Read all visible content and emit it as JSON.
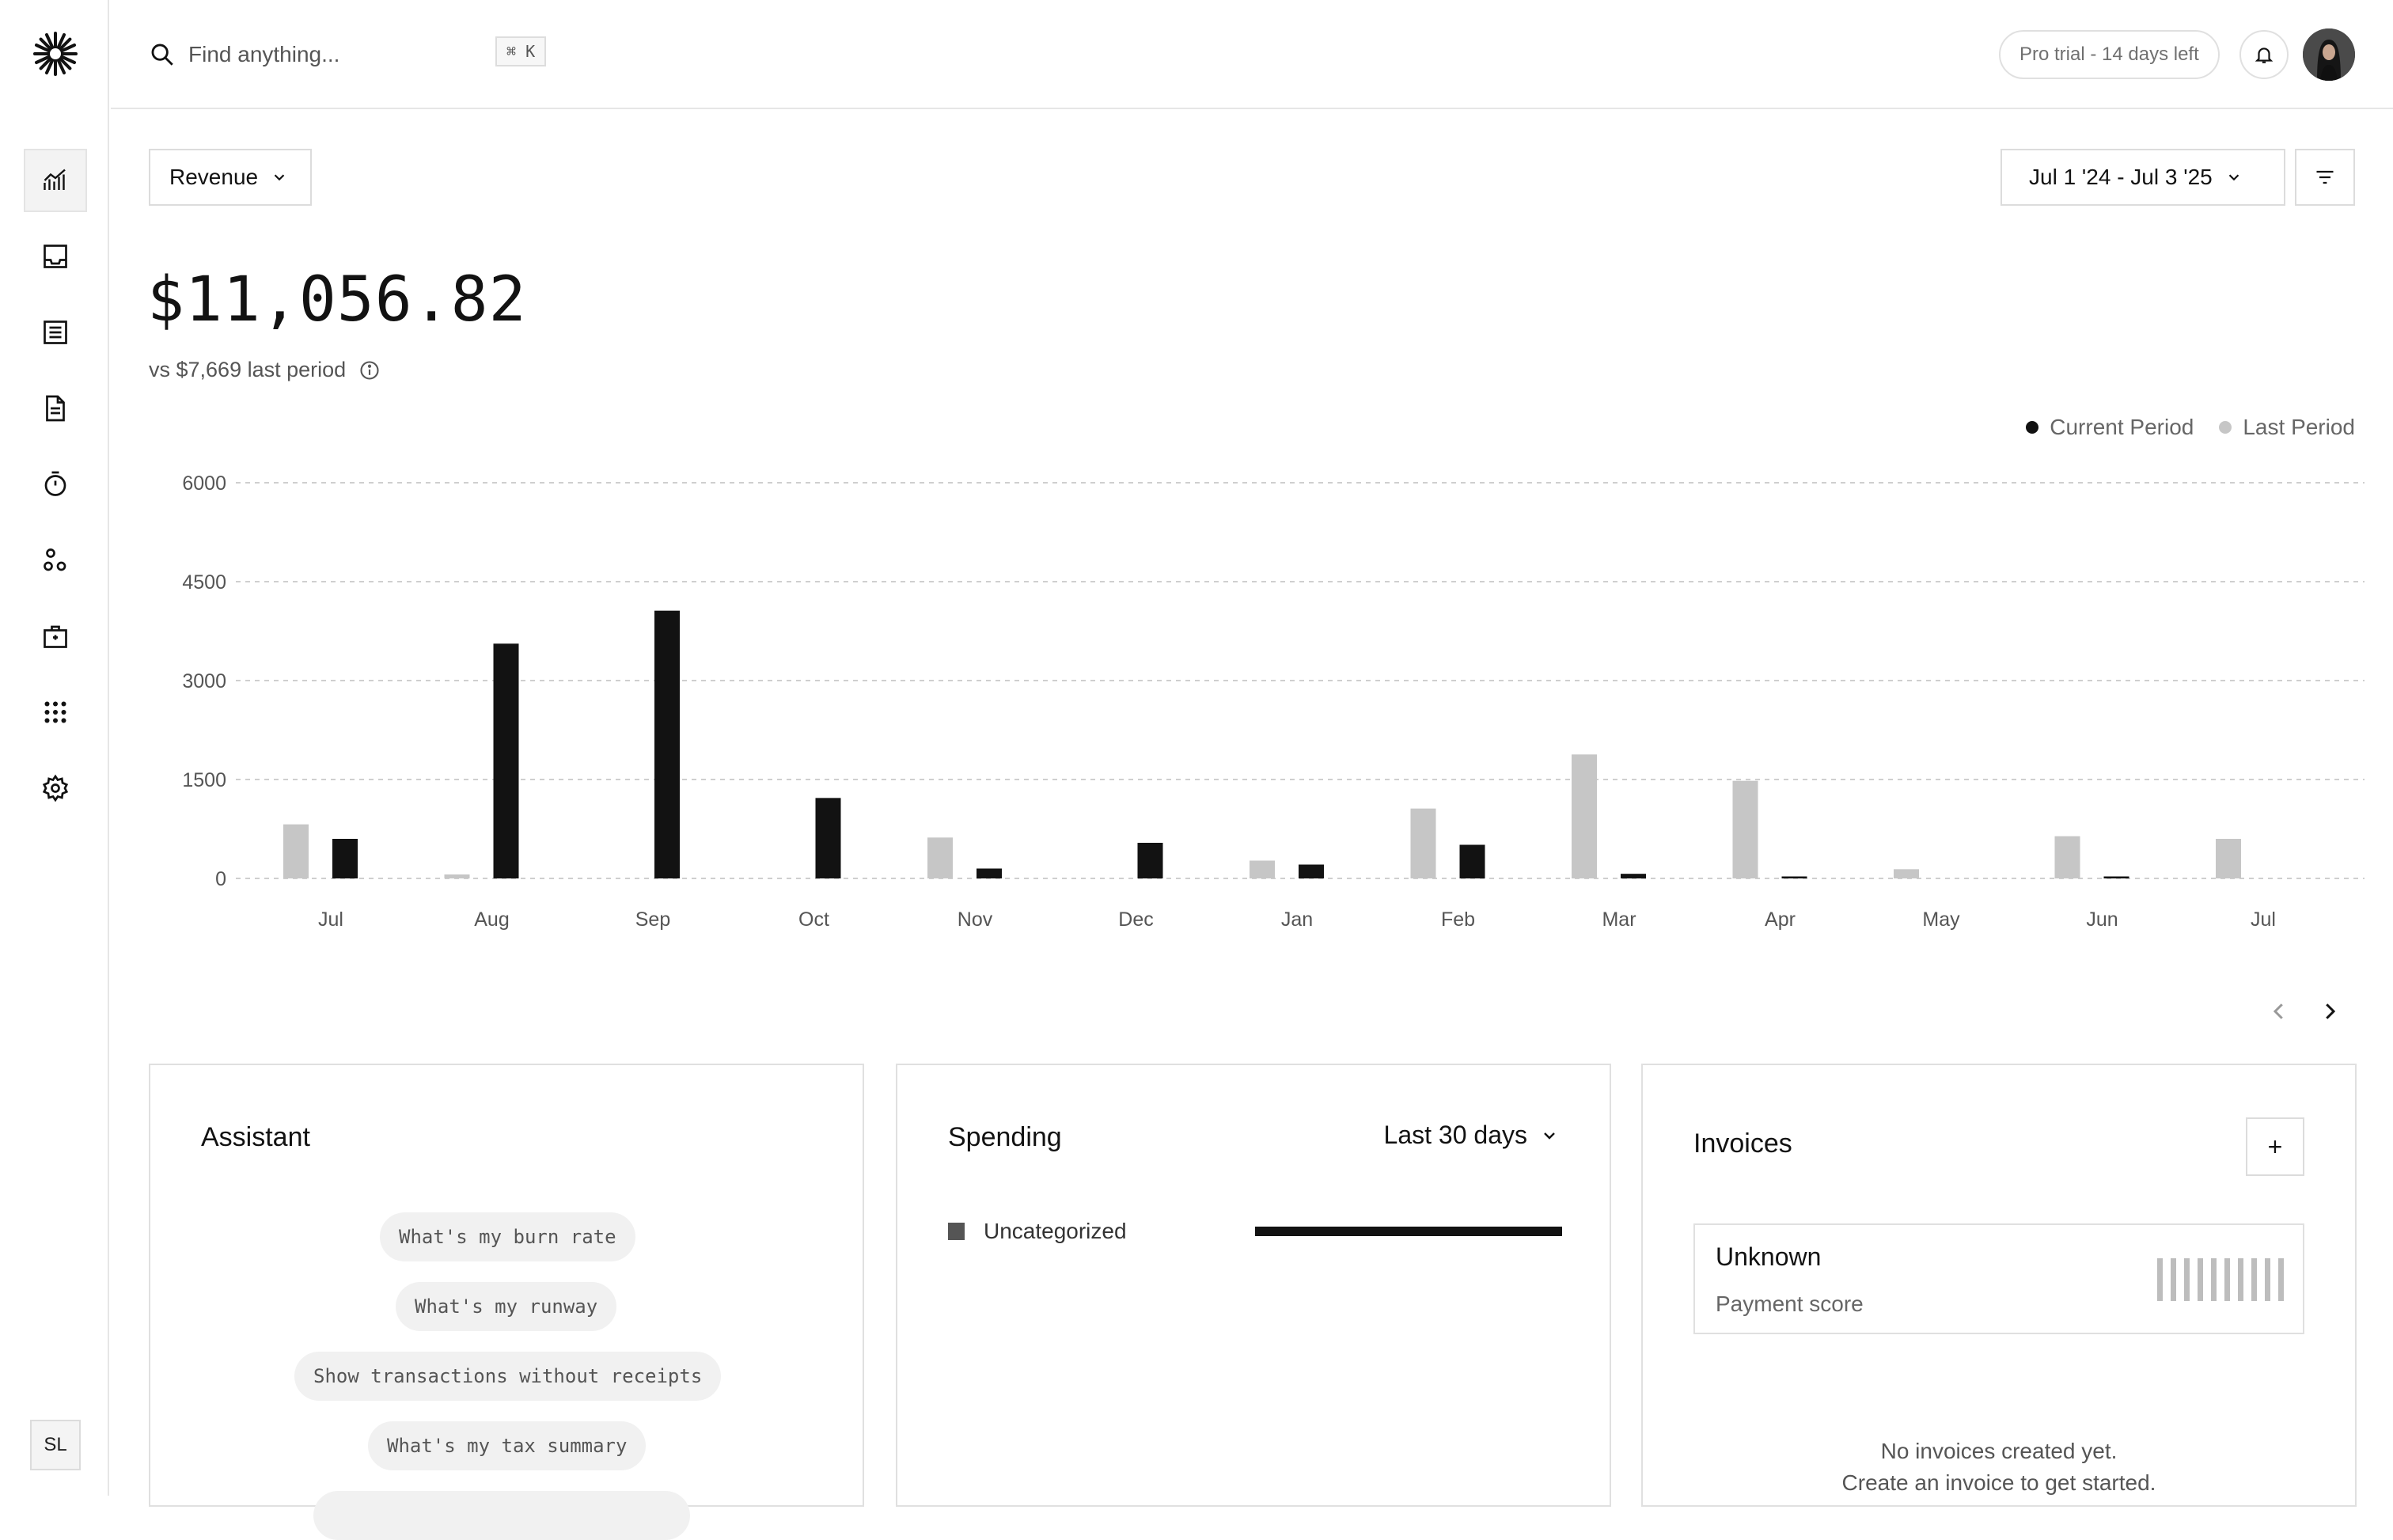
{
  "search": {
    "placeholder": "Find anything...",
    "shortcut": "⌘ K"
  },
  "header": {
    "trial_badge": "Pro trial - 14 days left"
  },
  "sidebar": {
    "items": [
      {
        "name": "overview",
        "icon": "chart-icon",
        "active": true
      },
      {
        "name": "inbox",
        "icon": "inbox-icon"
      },
      {
        "name": "transactions",
        "icon": "list-icon"
      },
      {
        "name": "invoices",
        "icon": "document-icon"
      },
      {
        "name": "tracker",
        "icon": "timer-icon"
      },
      {
        "name": "customers",
        "icon": "people-icon"
      },
      {
        "name": "vault",
        "icon": "briefcase-icon"
      },
      {
        "name": "apps",
        "icon": "grid-icon"
      },
      {
        "name": "settings",
        "icon": "gear-icon"
      }
    ],
    "user_initials": "SL"
  },
  "toolbar": {
    "metric_label": "Revenue",
    "date_range": "Jul 1 '24 - Jul 3 '25"
  },
  "summary": {
    "amount": "$11,056.82",
    "comparison": "vs $7,669 last period"
  },
  "legend": {
    "current": "Current Period",
    "last": "Last Period",
    "current_color": "#121212",
    "last_color": "#c6c6c6"
  },
  "chart_data": {
    "type": "bar",
    "categories": [
      "Jul",
      "Aug",
      "Sep",
      "Oct",
      "Nov",
      "Dec",
      "Jan",
      "Feb",
      "Mar",
      "Apr",
      "May",
      "Jun",
      "Jul"
    ],
    "series": [
      {
        "name": "Last Period",
        "color": "#c6c6c6",
        "values": [
          820,
          60,
          0,
          0,
          620,
          0,
          270,
          1060,
          1880,
          1480,
          140,
          640,
          600
        ]
      },
      {
        "name": "Current Period",
        "color": "#121212",
        "values": [
          600,
          3560,
          4060,
          1220,
          150,
          540,
          210,
          510,
          70,
          30,
          0,
          30,
          0
        ]
      }
    ],
    "yticks": [
      0,
      1500,
      3000,
      4500,
      6000
    ],
    "ylim": [
      0,
      6000
    ],
    "grid": true,
    "legend_position": "top-right"
  },
  "assistant": {
    "title": "Assistant",
    "suggestions": [
      "What's my burn rate",
      "What's my runway",
      "Show transactions without receipts",
      "What's my tax summary"
    ]
  },
  "spending": {
    "title": "Spending",
    "period": "Last 30 days",
    "categories": [
      {
        "label": "Uncategorized",
        "color": "#555555",
        "share": 1.0
      }
    ]
  },
  "invoices": {
    "title": "Invoices",
    "add_label": "+",
    "payment_score_value": "Unknown",
    "payment_score_label": "Payment score",
    "empty_line1": "No invoices created yet.",
    "empty_line2": "Create an invoice to get started."
  }
}
